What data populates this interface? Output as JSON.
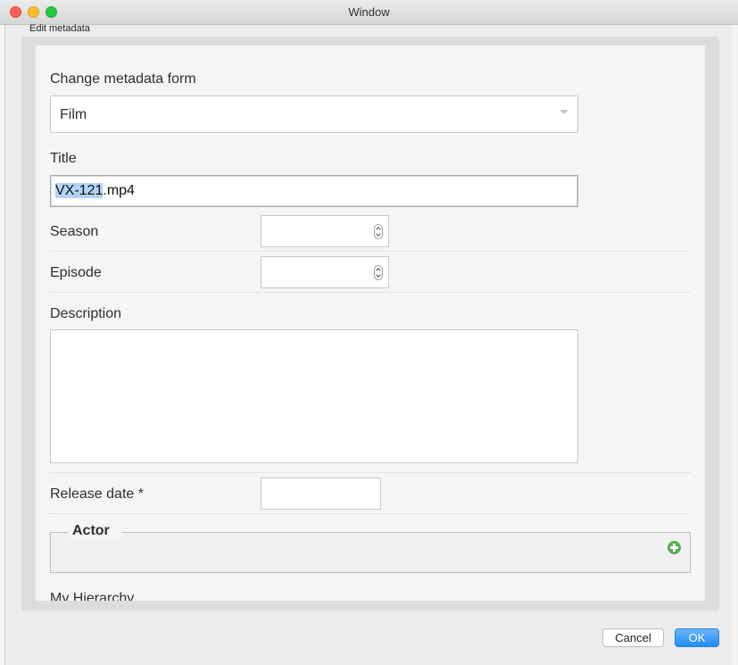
{
  "window": {
    "title": "Window"
  },
  "dialog": {
    "label": "Edit metadata"
  },
  "form": {
    "change_form_label": "Change metadata form",
    "form_select_value": "Film",
    "title_label": "Title",
    "title_value_selected": "VX-121",
    "title_value_rest": ".mp4",
    "season_label": "Season",
    "season_value": "",
    "episode_label": "Episode",
    "episode_value": "",
    "description_label": "Description",
    "description_value": "",
    "release_date_label": "Release date *",
    "release_date_value": "",
    "actor_legend": "Actor",
    "hierarchy_label": "My Hierarchy"
  },
  "buttons": {
    "cancel": "Cancel",
    "ok": "OK"
  },
  "icons": {
    "add": "plus-circle-icon",
    "spinner": "stepper-icon",
    "dropdown": "chevron-down-icon"
  },
  "colors": {
    "accent": "#1f8df7",
    "add_icon": "#5cac55",
    "selection": "#b3d3f5"
  }
}
